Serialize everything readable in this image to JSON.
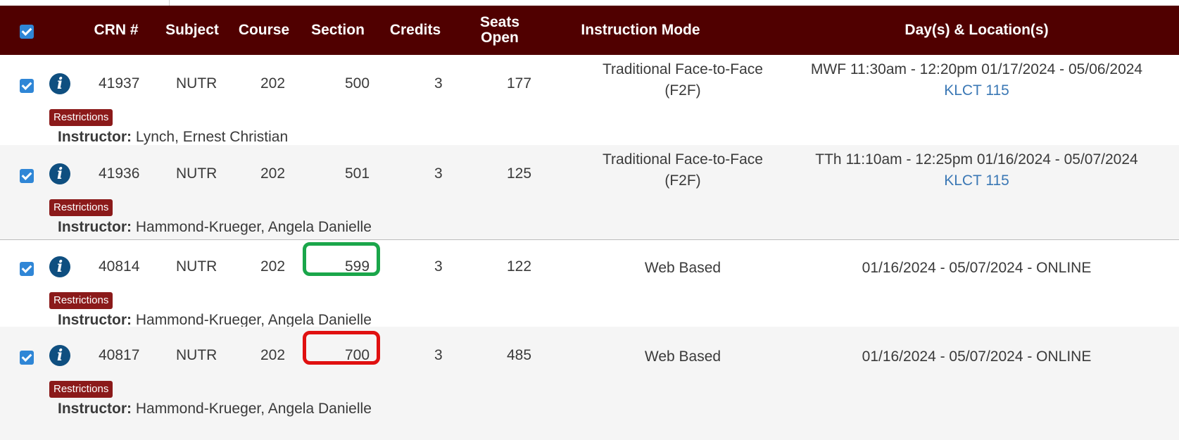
{
  "header": {
    "crn": "CRN #",
    "subject": "Subject",
    "course": "Course",
    "section": "Section",
    "credits": "Credits",
    "seats": "Seats Open",
    "mode": "Instruction Mode",
    "days": "Day(s) & Location(s)"
  },
  "colors": {
    "header_bg": "#500000",
    "checkbox": "#2f86d6",
    "info_icon": "#0f4f80",
    "badge": "#8b1a1a",
    "link": "#3b78b5",
    "highlight_green": "#1aa64a",
    "highlight_red": "#e01010"
  },
  "rows": [
    {
      "crn": "41937",
      "subject": "NUTR",
      "course": "202",
      "section": "500",
      "credits": "3",
      "seats": "177",
      "mode_line1": "Traditional Face-to-Face",
      "mode_line2": "(F2F)",
      "days_line1": "MWF 11:30am - 12:20pm 01/17/2024 - 05/06/2024",
      "location": "KLCT 115",
      "badge": "Restrictions",
      "instructor_label": "Instructor:",
      "instructor": "Lynch, Ernest Christian"
    },
    {
      "crn": "41936",
      "subject": "NUTR",
      "course": "202",
      "section": "501",
      "credits": "3",
      "seats": "125",
      "mode_line1": "Traditional Face-to-Face",
      "mode_line2": "(F2F)",
      "days_line1": "TTh 11:10am - 12:25pm 01/16/2024 - 05/07/2024",
      "location": "KLCT 115",
      "badge": "Restrictions",
      "instructor_label": "Instructor:",
      "instructor": "Hammond-Krueger, Angela Danielle"
    },
    {
      "crn": "40814",
      "subject": "NUTR",
      "course": "202",
      "section": "599",
      "credits": "3",
      "seats": "122",
      "mode_line1": "Web Based",
      "days_line1": "01/16/2024 - 05/07/2024 - ONLINE",
      "badge": "Restrictions",
      "instructor_label": "Instructor:",
      "instructor": "Hammond-Krueger, Angela Danielle"
    },
    {
      "crn": "40817",
      "subject": "NUTR",
      "course": "202",
      "section": "700",
      "credits": "3",
      "seats": "485",
      "mode_line1": "Web Based",
      "days_line1": "01/16/2024 - 05/07/2024 - ONLINE",
      "badge": "Restrictions",
      "instructor_label": "Instructor:",
      "instructor": "Hammond-Krueger, Angela Danielle"
    }
  ]
}
